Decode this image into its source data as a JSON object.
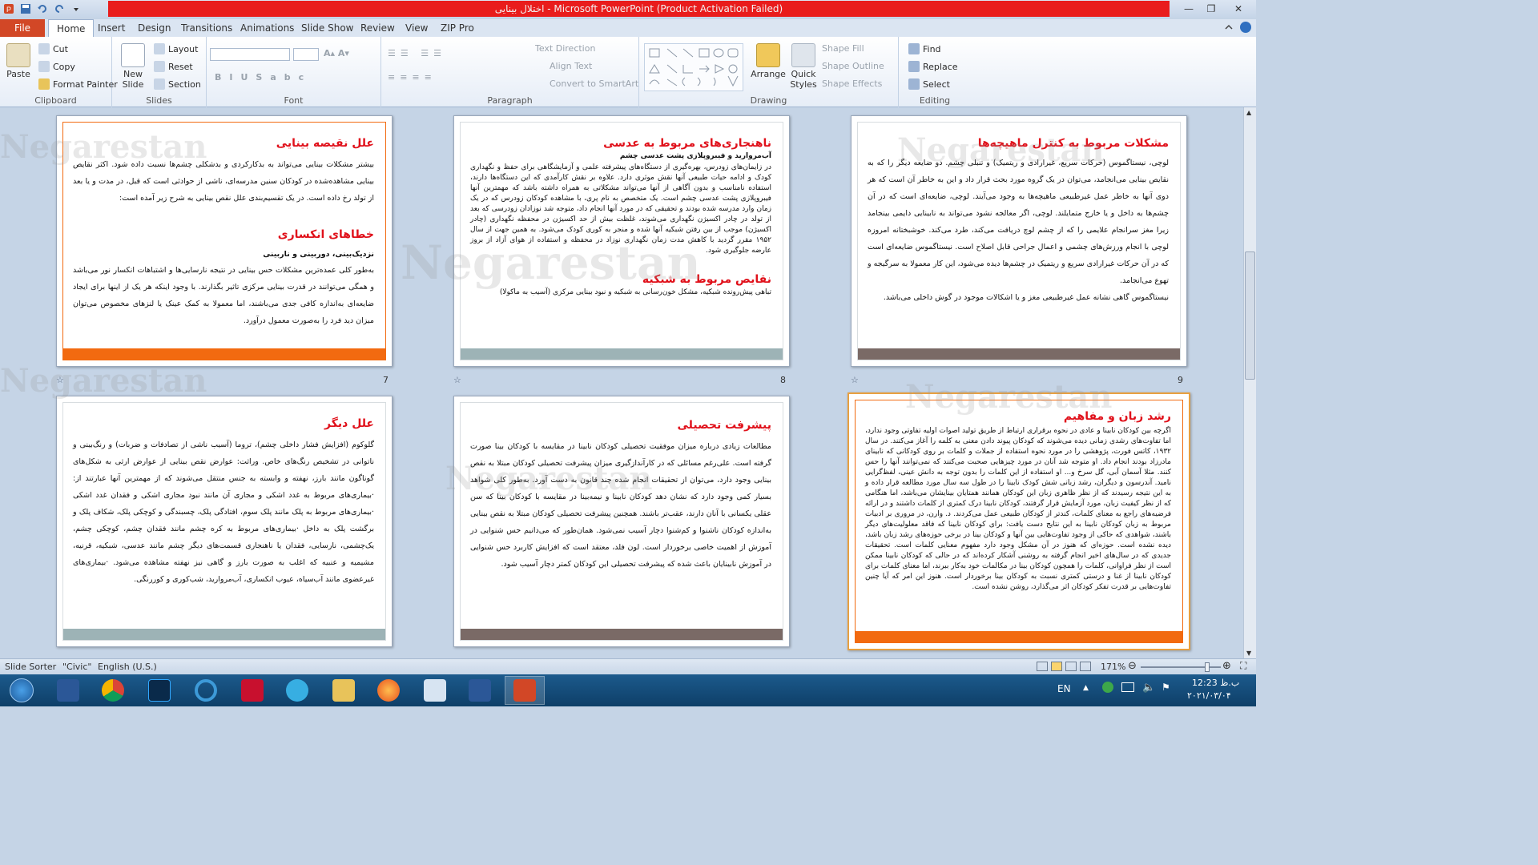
{
  "window": {
    "title": "اختلال بینایی - Microsoft PowerPoint (Product Activation Failed)"
  },
  "tabs": [
    {
      "label": "File"
    },
    {
      "label": "Home"
    },
    {
      "label": "Insert"
    },
    {
      "label": "Design"
    },
    {
      "label": "Transitions"
    },
    {
      "label": "Animations"
    },
    {
      "label": "Slide Show"
    },
    {
      "label": "Review"
    },
    {
      "label": "View"
    },
    {
      "label": "ZIP Pro"
    }
  ],
  "ribbon": {
    "clipboard": {
      "label": "Clipboard",
      "paste": "Paste",
      "cut": "Cut",
      "copy": "Copy",
      "format_painter": "Format Painter"
    },
    "slides": {
      "label": "Slides",
      "new_slide": "New Slide",
      "layout": "Layout",
      "reset": "Reset",
      "section": "Section"
    },
    "font": {
      "label": "Font"
    },
    "paragraph": {
      "label": "Paragraph",
      "text_direction": "Text Direction",
      "align_text": "Align Text",
      "convert_smartart": "Convert to SmartArt"
    },
    "drawing": {
      "label": "Drawing",
      "arrange": "Arrange",
      "quick_styles": "Quick Styles",
      "shape_fill": "Shape Fill",
      "shape_outline": "Shape Outline",
      "shape_effects": "Shape Effects"
    },
    "editing": {
      "label": "Editing",
      "find": "Find",
      "replace": "Replace",
      "select": "Select"
    }
  },
  "watermark": "Negarestan",
  "slides": [
    {
      "number": "7",
      "title": "علل نقیصه بینایی",
      "body": "بیشتر مشکلات بینایی می‌تواند به بدکارکردی و بدشکلی چشم‌ها نسبت داده شود. اکثر نقایص بینایی مشاهده‌شده در کودکان سنین مدرسه‌ای، ناشی از حوادثی است که قبل، در مدت و یا بعد از تولد رخ داده است. در یک تقسیم‌بندی علل نقص بینایی به شرح زیر آمده است:",
      "title2": "خطاهای انکساری",
      "sub2": "نزدیک‌بینی، دوربینی و ناربینی",
      "body2": "به‌طور کلی عمده‌ترین مشکلات حس بینایی در نتیجه نارسایی‌ها و اشتباهات انکسار نور می‌باشد و همگی می‌توانند در قدرت بینایی مرکزی تاثیر بگذارند. با وجود اینکه هر یک از اینها برای ایجاد ضایعه‌ای به‌اندازه کافی جدی می‌باشند، اما معمولا به کمک عینک یا لنزهای مخصوص می‌توان میزان دید فرد را به‌صورت معمول درآورد.",
      "bar_color": "#f26a10"
    },
    {
      "number": "8",
      "title": "ناهنجاری‌های مربوط به عدسی",
      "sub": "آب‌مروارید و فیبروپلازی پشت عدسی چشم",
      "body": "در زایمان‌های زودرس، بهره‌گیری از دستگاه‌های پیشرفته علمی و آزمایشگاهی برای حفظ و نگهداری کودک و ادامه حیات طبیعی آنها نقش موثری دارد. علاوه بر نقش کارآمدی که این دستگاه‌ها دارند، استفاده نامناسب و بدون آگاهی از آنها می‌تواند مشکلاتی به همراه داشته باشد که مهمترین آنها فیبروپلازی پشت عدسی چشم است. یک متخصص به نام پری، با مشاهده کودکان زودرس که در یک زمان وارد مدرسه شده بودند و تحقیقی که در مورد آنها انجام داد، متوجه شد نوزادان زودرسی که بعد از تولد در چادر اکسیژن نگهداری می‌شوند، غلظت بیش از حد اکسیژن در محفظه نگهداری (چادر اکسیژن) موجب از بین رفتن شبکیه آنها شده و منجر به کوری کودک می‌شود. به همین جهت از سال ۱۹۵۲ مقرر گردید با کاهش مدت زمان نگهداری نوزاد در محفظه و استفاده از هوای آزاد از بروز عارضه جلوگیری شود.",
      "title2": "نقایص مربوط به شبکیه",
      "body2": "تباهی پیش‌رونده شبکیه، مشکل خون‌رسانی به شبکیه و نبود بینایی مرکزی (آسیب به ماکولا)",
      "bar_color": "#9db3b6"
    },
    {
      "number": "9",
      "title": "مشکلات مربوط به کنترل ماهیچه‌ها",
      "body": "لوچی، نیستاگموس (حرکات سریع، غیرارادی و ریتمیک) و تنبلی چشم. دو ضایعه دیگر را که به نقایص بینایی می‌انجامد، می‌توان در یک گروه مورد بحث قرار داد و این به خاطر آن است که هر دوی آنها به خاطر عمل غیرطبیعی ماهیچه‌ها به وجود می‌آیند. لوچی، ضایعه‌ای است که در آن چشم‌ها به داخل و یا خارج متمایلند. لوچی، اگر معالجه نشود می‌تواند به نابینایی دایمی بینجامد زیرا مغز سرانجام علایمی را که از چشم لوچ دریافت می‌کند، طرد می‌کند. خوشبختانه امروزه لوچی با انجام ورزش‌های چشمی و اعمال جراحی قابل اصلاح است. نیستاگموس ضایعه‌ای است که در آن حرکات غیرارادی سریع و ریتمیک در چشم‌ها دیده می‌شود، این کار معمولا به سرگیجه و تهوع می‌انجامد.",
      "body2": "نیستاگموس گاهی نشانه عمل غیرطبیعی مغز و یا اشکالات موجود در گوش داخلی می‌باشد.",
      "bar_color": "#7a6a66"
    },
    {
      "number": "",
      "title": "علل دیگر",
      "body": "گلوکوم (افزایش فشار داخلی چشم)، تروما (آسیب ناشی از تصادفات و ضربات) و رنگ‌بینی و ناتوانی در تشخیص رنگ‌های خاص. وراثت: عوارض نقص بینایی از عوارض ارثی به شکل‌های گوناگون مانند بارز، نهفته و وابسته به جنس منتقل می‌شوند که از مهمترین آنها عبارتند از: ·بیماری‌های مربوط به غدد اشکی و مجاری آن مانند نبود مجاری اشکی و فقدان غدد اشکی ·بیماری‌های مربوط به پلک مانند پلک سوم، افتادگی پلک، چسبندگی و کوچکی پلک، شکاف پلک و برگشت پلک به داخل ·بیماری‌های مربوط به کره چشم مانند فقدان چشم، کوچکی چشم، یک‌چشمی، نارسایی، فقدان یا ناهنجاری قسمت‌های دیگر چشم مانند عدسی، شبکیه، قرنیه، مشیمیه و عنبیه که اغلب به صورت بارز و گاهی نیز نهفته مشاهده می‌شود. ·بیماری‌های غیرعضوی مانند آب‌سیاه، عیوب انکساری، آب‌مروارید، شب‌کوری و کوررنگی.",
      "bar_color": "#9db3b6"
    },
    {
      "number": "",
      "title": "پیشرفت تحصیلی",
      "body": "مطالعات زیادی درباره میزان موفقیت تحصیلی کودکان نابینا در مقایسه با کودکان بینا صورت گرفته است. علی‌رغم مسائلی که در کارآندازگیری میزان پیشرفت تحصیلی کودکان مبتلا به نقص بینایی وجود دارد، می‌توان از تحقیقات انجام شده چند قانون به دست آورد. به‌طور کلی شواهد بسیار کمی وجود دارد که نشان دهد کودکان نابینا و نیمه‌بینا در مقایسه با کودکان بینا که سن عقلی یکسانی با آنان دارند، عقب‌تر باشند. همچنین پیشرفت تحصیلی کودکان مبتلا به نقص بینایی به‌اندازه کودکان ناشنوا و کم‌شنوا دچار آسیب نمی‌شود. همان‌طور که می‌دانیم حس شنوایی در آموزش از اهمیت خاصی برخوردار است. لون فلد، معتقد است که افزایش کاربرد حس شنوایی در آموزش نابینایان باعث شده که پیشرفت تحصیلی این کودکان کمتر دچار آسیب شود.",
      "bar_color": "#7a6a66"
    },
    {
      "number": "",
      "title": "رشد زبان و مفاهیم",
      "body": "اگرچه بین کودکان نابینا و عادی در نحوه برقراری ارتباط از طریق تولید اصوات اولیه تفاوتی وجود ندارد، اما تفاوت‌های رشدی زمانی دیده می‌شوند که کودکان پیوند دادن معنی به کلمه را آغاز می‌کنند. در سال ۱۹۳۲، کاتس فورت، پژوهشی را در مورد نحوه استفاده از جملات و کلمات بر روی کودکانی که نابینای مادرزاد بودند انجام داد. او متوجه شد آنان در مورد چیزهایی صحبت می‌کنند که نمی‌توانند آنها را حس کنند. مثلا آسمان آبی، گل سرخ و... او استفاده از این کلمات را بدون توجه به دانش عینی، لفظ‌گرایی نامید. آندرسون و دیگران، رشد زبانی شش کودک نابینا را در طول سه سال مورد مطالعه قرار داده و به این نتیجه رسیدند که از نظر ظاهری زبان این کودکان همانند همتایان بینایشان می‌باشد، اما هنگامی که از نظر کیفیت زبان، مورد آزمایش قرار گرفتند، کودکان نابینا درک کمتری از کلمات داشتند و در ارائه فرضیه‌های راجع به معنای کلمات، کندتر از کودکان طبیعی عمل می‌کردند. د. وارن، در مروری بر ادبیات مربوط به زبان کودکان نابینا به این نتایج دست یافت: برای کودکان نابینا که فاقد معلولیت‌های دیگر باشند، شواهدی که حاکی از وجود تفاوت‌هایی بین آنها و کودکان بینا در برخی حوزه‌های رشد زبان باشد، دیده نشده است. حوزه‌ای که هنوز در آن مشکل وجود دارد مفهوم معنایی کلمات است. تحقیقات جدیدی که در سال‌های اخیر انجام گرفته به روشنی آشکار کرده‌اند که در حالی که کودکان نابینا ممکن است از نظر فراوانی، کلمات را همچون کودکان بینا در مکالمات خود به‌کار ببرند، اما معنای کلمات برای کودکان نابینا از غنا و درستی کمتری نسبت به کودکان بینا برخوردار است. هنوز این امر که آیا چنین تفاوت‌هایی بر قدرت تفکر کودکان اثر می‌گذارد، روشن نشده است.",
      "bar_color": "#f26a10"
    }
  ],
  "status": {
    "view": "Slide Sorter",
    "theme": "\"Civic\"",
    "language": "English (U.S.)",
    "zoom": "171%"
  },
  "taskbar": {
    "lang": "EN",
    "time": "12:23 ب.ظ",
    "date": "۲۰۲۱/۰۳/۰۴"
  }
}
